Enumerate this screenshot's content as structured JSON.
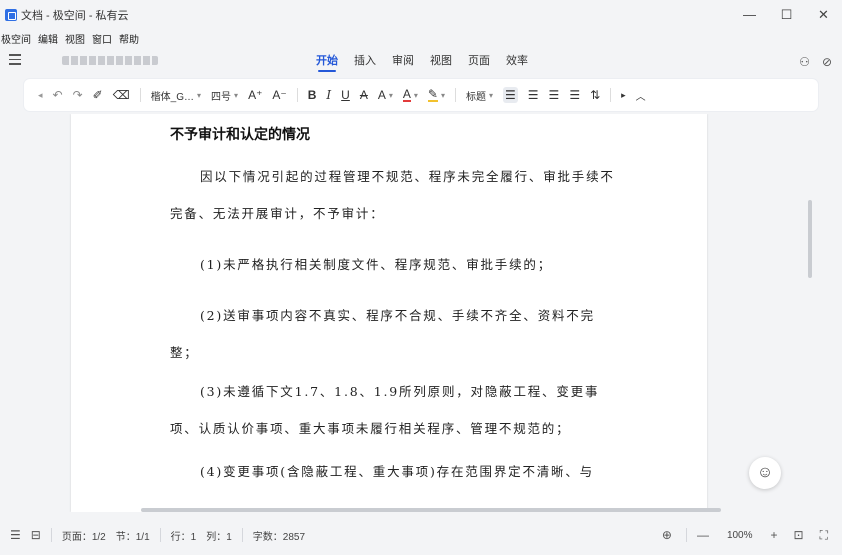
{
  "window": {
    "title": "文档 - 极空间 - 私有云",
    "controls": [
      "—",
      "☐",
      "✕"
    ]
  },
  "menubar": [
    "极空间",
    "编辑",
    "视图",
    "窗口",
    "帮助"
  ],
  "ribbon": {
    "tabs": [
      "开始",
      "插入",
      "审阅",
      "视图",
      "页面",
      "效率"
    ],
    "active_tab": "开始",
    "accent_color": "#2458d8"
  },
  "toolbar": {
    "font_name": "楷体_G…",
    "font_size": "四号",
    "grow_font": "A⁺",
    "shrink_font": "A⁻",
    "bold": "B",
    "italic": "I",
    "underline": "U",
    "strike": "A",
    "font_effect": "A",
    "font_color": "A",
    "highlight": "✎",
    "style": "标题"
  },
  "document": {
    "heading": "不予审计和认定的情况",
    "paragraphs": [
      "因以下情况引起的过程管理不规范、程序未完全履行、审批手续不完备、无法开展审计，不予审计：",
      "(1)未严格执行相关制度文件、程序规范、审批手续的；",
      "(2)送审事项内容不真实、程序不合规、手续不齐全、资料不完整；",
      "(3)未遵循下文1.7、1.8、1.9所列原则，对隐蔽工程、变更事项、认质认价事项、重大事项未履行相关程序、管理不规范的；",
      "(4)变更事项(含隐蔽工程、重大事项)存在范围界定不清晰、与"
    ]
  },
  "statusbar": {
    "page": "页面：1/2",
    "section": "节：1/1",
    "row": "行：1",
    "col": "列：1",
    "word_count": "字数：2857",
    "zoom": "100%"
  }
}
